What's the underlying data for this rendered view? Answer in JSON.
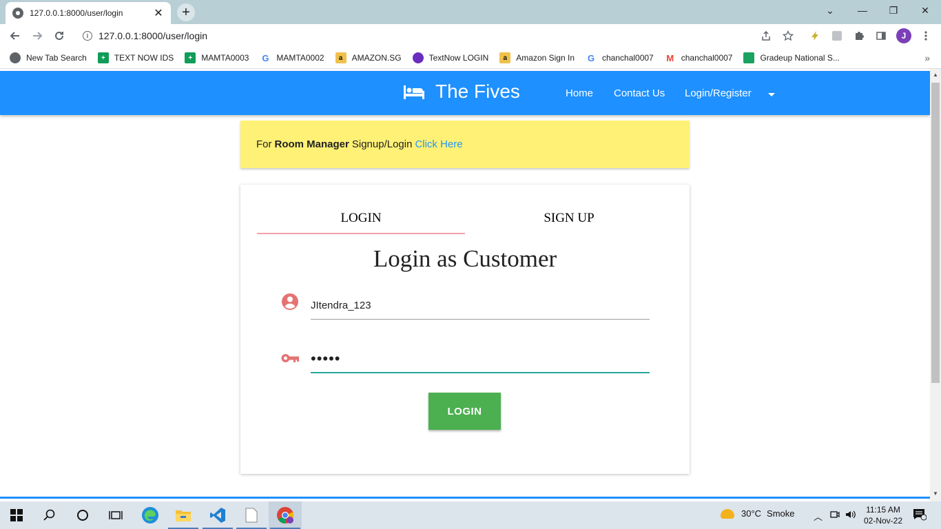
{
  "browser": {
    "tab_title": "127.0.0.1:8000/user/login",
    "tab_close": "✕",
    "new_tab": "+",
    "url": "127.0.0.1:8000/user/login",
    "avatar_letter": "J",
    "window_controls": {
      "minimize": "—",
      "restore": "❐",
      "close": "✕",
      "tabsearch": "⌄"
    }
  },
  "bookmarks": [
    {
      "label": "New Tab Search",
      "icon": "globe-icon",
      "color": "#5f6368"
    },
    {
      "label": "TEXT NOW IDS",
      "icon": "sheets-icon",
      "color": "#0f9d58"
    },
    {
      "label": "MAMTA0003",
      "icon": "sheets-icon",
      "color": "#0f9d58"
    },
    {
      "label": "MAMTA0002",
      "icon": "google-icon",
      "color": "#4285f4"
    },
    {
      "label": "AMAZON.SG",
      "icon": "amazon-icon",
      "color": "#f0c14b"
    },
    {
      "label": "TextNow LOGIN",
      "icon": "textnow-icon",
      "color": "#6a2dbd"
    },
    {
      "label": "Amazon Sign In",
      "icon": "amazon-icon",
      "color": "#f0c14b"
    },
    {
      "label": "chanchal0007",
      "icon": "google-icon",
      "color": "#4285f4"
    },
    {
      "label": "chanchal0007",
      "icon": "gmail-icon",
      "color": "#ea4335"
    },
    {
      "label": "Gradeup National S...",
      "icon": "gradeup-icon",
      "color": "#1aa260"
    }
  ],
  "site": {
    "brand": "The Fives",
    "nav": {
      "home": "Home",
      "contact": "Contact Us",
      "login_register": "Login/Register"
    },
    "notice": {
      "prefix": "For",
      "bold": "Room Manager",
      "middle": "Signup/Login",
      "link": "Click Here"
    },
    "tabs": {
      "login": "LOGIN",
      "signup": "SIGN UP"
    },
    "title": "Login as Customer",
    "username_value": "JItendra_123",
    "password_value": "•••••",
    "login_button": "LOGIN",
    "colors": {
      "navbar": "#1e90ff",
      "notice": "#fff176",
      "button": "#4caf50",
      "icon": "#e57373",
      "focus": "#26a69a"
    }
  },
  "taskbar": {
    "weather_temp": "30°C",
    "weather_desc": "Smoke",
    "time": "11:15 AM",
    "date": "02-Nov-22"
  }
}
